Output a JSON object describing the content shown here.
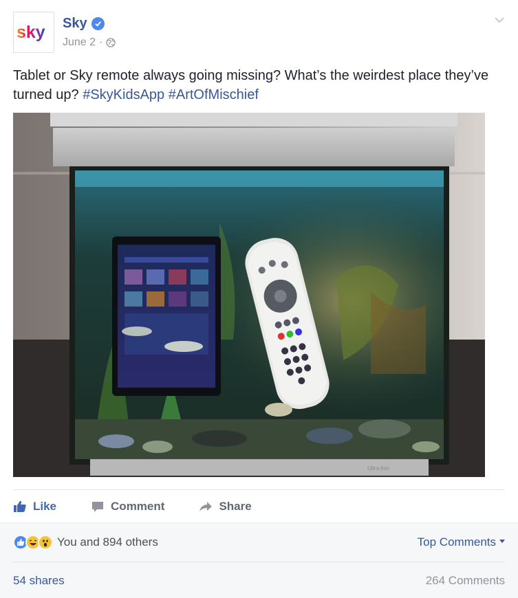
{
  "post": {
    "page_name": "Sky",
    "date": "June 2",
    "separator": "·",
    "text_main": "Tablet or Sky remote always going missing? What’s the weirdest place they’ve turned up?",
    "hashtags": [
      "#SkyKidsApp",
      "#ArtOfMischief"
    ],
    "logo_text": "sky",
    "photo_label": "Ultra-fish"
  },
  "actions": {
    "like": "Like",
    "comment": "Comment",
    "share": "Share"
  },
  "footer": {
    "reactions_text": "You and 894 others",
    "top_comments": "Top Comments",
    "shares": "54 shares",
    "comments": "264 Comments"
  },
  "colors": {
    "link": "#365899",
    "like_blue": "#4267b2",
    "muted": "#90949c",
    "footer_bg": "#f6f7f9"
  },
  "icons": [
    "sky-logo-icon",
    "verified-badge-icon",
    "globe-icon",
    "chevron-down-icon",
    "like-thumb-icon",
    "comment-bubble-icon",
    "share-arrow-icon",
    "reaction-like-icon",
    "reaction-haha-icon",
    "reaction-wow-icon"
  ]
}
